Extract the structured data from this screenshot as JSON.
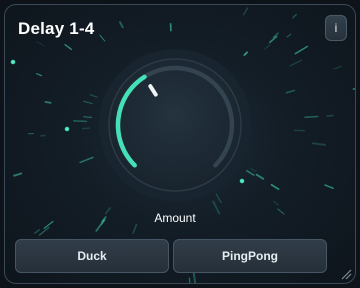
{
  "panel": {
    "title": "Delay 1-4",
    "info_label": "i"
  },
  "knob": {
    "label": "Amount",
    "value": 0.38,
    "accent": "#46e0b8"
  },
  "buttons": {
    "duck_label": "Duck",
    "pingpong_label": "PingPong"
  },
  "icons": {
    "resize": "resize-grip-icon"
  }
}
